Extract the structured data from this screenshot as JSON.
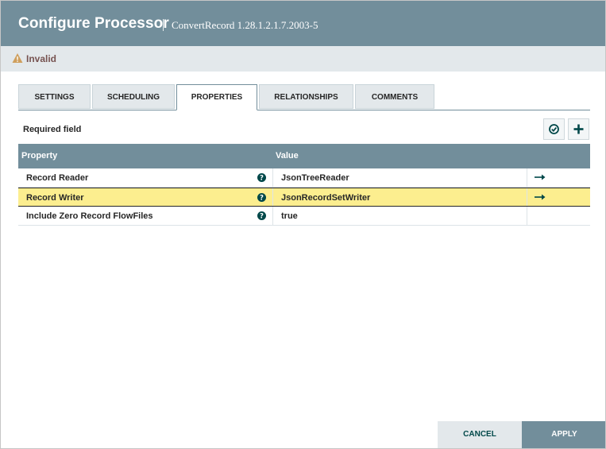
{
  "dialog": {
    "title": "Configure Processor",
    "subtitle": "ConvertRecord 1.28.1.2.1.7.2003-5",
    "status_text": "Invalid"
  },
  "tabs": [
    {
      "label": "SETTINGS",
      "active": false
    },
    {
      "label": "SCHEDULING",
      "active": false
    },
    {
      "label": "PROPERTIES",
      "active": true
    },
    {
      "label": "RELATIONSHIPS",
      "active": false
    },
    {
      "label": "COMMENTS",
      "active": false
    }
  ],
  "properties": {
    "required_label": "Required field",
    "columns": {
      "property": "Property",
      "value": "Value"
    },
    "rows": [
      {
        "name": "Record Reader",
        "value": "JsonTreeReader",
        "has_link": true,
        "selected": false
      },
      {
        "name": "Record Writer",
        "value": "JsonRecordSetWriter",
        "has_link": true,
        "selected": true
      },
      {
        "name": "Include Zero Record FlowFiles",
        "value": "true",
        "has_link": false,
        "selected": false
      }
    ]
  },
  "footer": {
    "cancel_label": "CANCEL",
    "apply_label": "APPLY"
  },
  "colors": {
    "header": "#728e9b",
    "accent_dark": "#004849",
    "selected_row": "#fcee8f",
    "warning": "#cf9f5d",
    "status_text": "#775351"
  },
  "icons": {
    "status": "warning-icon",
    "verify": "check-circle-icon",
    "add": "plus-icon",
    "help": "question-circle-icon",
    "link": "arrow-right-icon"
  }
}
